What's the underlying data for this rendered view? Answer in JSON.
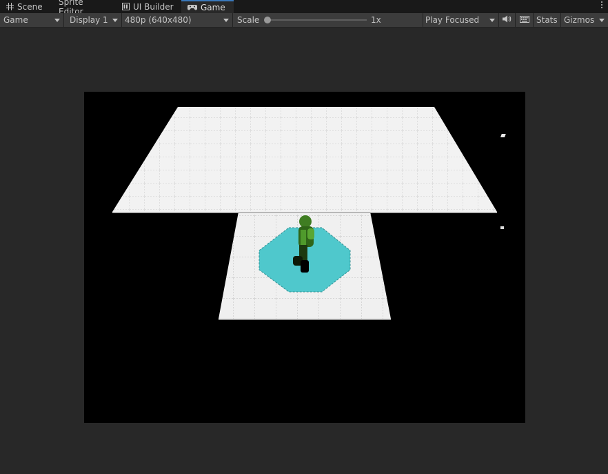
{
  "tabs": [
    {
      "label": "Scene",
      "icon": "grid-icon",
      "active": false
    },
    {
      "label": "Sprite Editor",
      "icon": "",
      "active": false
    },
    {
      "label": "UI Builder",
      "icon": "ui-builder-icon",
      "active": false
    },
    {
      "label": "Game",
      "icon": "gamepad-icon",
      "active": true
    }
  ],
  "toolbar": {
    "view_select": "Game",
    "display_select": "Display 1",
    "resolution_select": "480p (640x480)",
    "scale_label": "Scale",
    "scale_value": "1x",
    "scale_fraction": 0.0,
    "play_mode_select": "Play Focused",
    "audio_icon": "speaker-icon",
    "keyboard_icon": "keyboard-icon",
    "stats_label": "Stats",
    "gizmos_label": "Gizmos"
  },
  "colors": {
    "tab_accent": "#3a79bb",
    "floor": "#f2f2f2",
    "area_marker": "#4fc8cc",
    "character": "#3f7d22",
    "background": "#000000"
  }
}
